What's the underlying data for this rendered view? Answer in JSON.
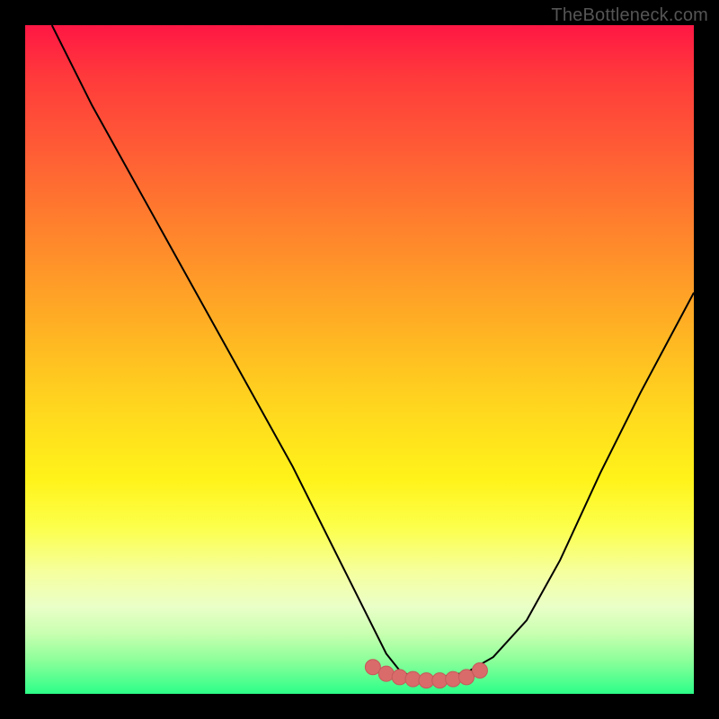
{
  "watermark": "TheBottleneck.com",
  "colors": {
    "background": "#000000",
    "curve_stroke": "#000000",
    "marker_fill": "#d96b6b",
    "marker_stroke": "#c45a5a"
  },
  "chart_data": {
    "type": "line",
    "title": "",
    "xlabel": "",
    "ylabel": "",
    "xlim": [
      0,
      100
    ],
    "ylim": [
      0,
      100
    ],
    "series": [
      {
        "name": "left-curve",
        "x": [
          4,
          10,
          20,
          30,
          40,
          48,
          54,
          56,
          58,
          60,
          62
        ],
        "y": [
          100,
          88,
          70,
          52,
          34,
          18,
          6,
          3.5,
          2.5,
          2.2,
          2.5
        ]
      },
      {
        "name": "right-curve",
        "x": [
          62,
          66,
          70,
          75,
          80,
          86,
          92,
          100
        ],
        "y": [
          2.5,
          3.2,
          5.5,
          11,
          20,
          33,
          45,
          60
        ]
      }
    ],
    "markers": {
      "name": "highlight-band",
      "x": [
        52,
        54,
        56,
        58,
        60,
        62,
        64,
        66,
        68
      ],
      "y": [
        4.0,
        3.0,
        2.5,
        2.2,
        2.0,
        2.0,
        2.2,
        2.5,
        3.5
      ]
    },
    "gradient_stops": [
      {
        "pos": 0,
        "color": "#ff1744"
      },
      {
        "pos": 18,
        "color": "#ff5a36"
      },
      {
        "pos": 38,
        "color": "#ff9a28"
      },
      {
        "pos": 58,
        "color": "#ffd91e"
      },
      {
        "pos": 75,
        "color": "#fcff4a"
      },
      {
        "pos": 91,
        "color": "#c8ffb0"
      },
      {
        "pos": 100,
        "color": "#2cff88"
      }
    ]
  }
}
